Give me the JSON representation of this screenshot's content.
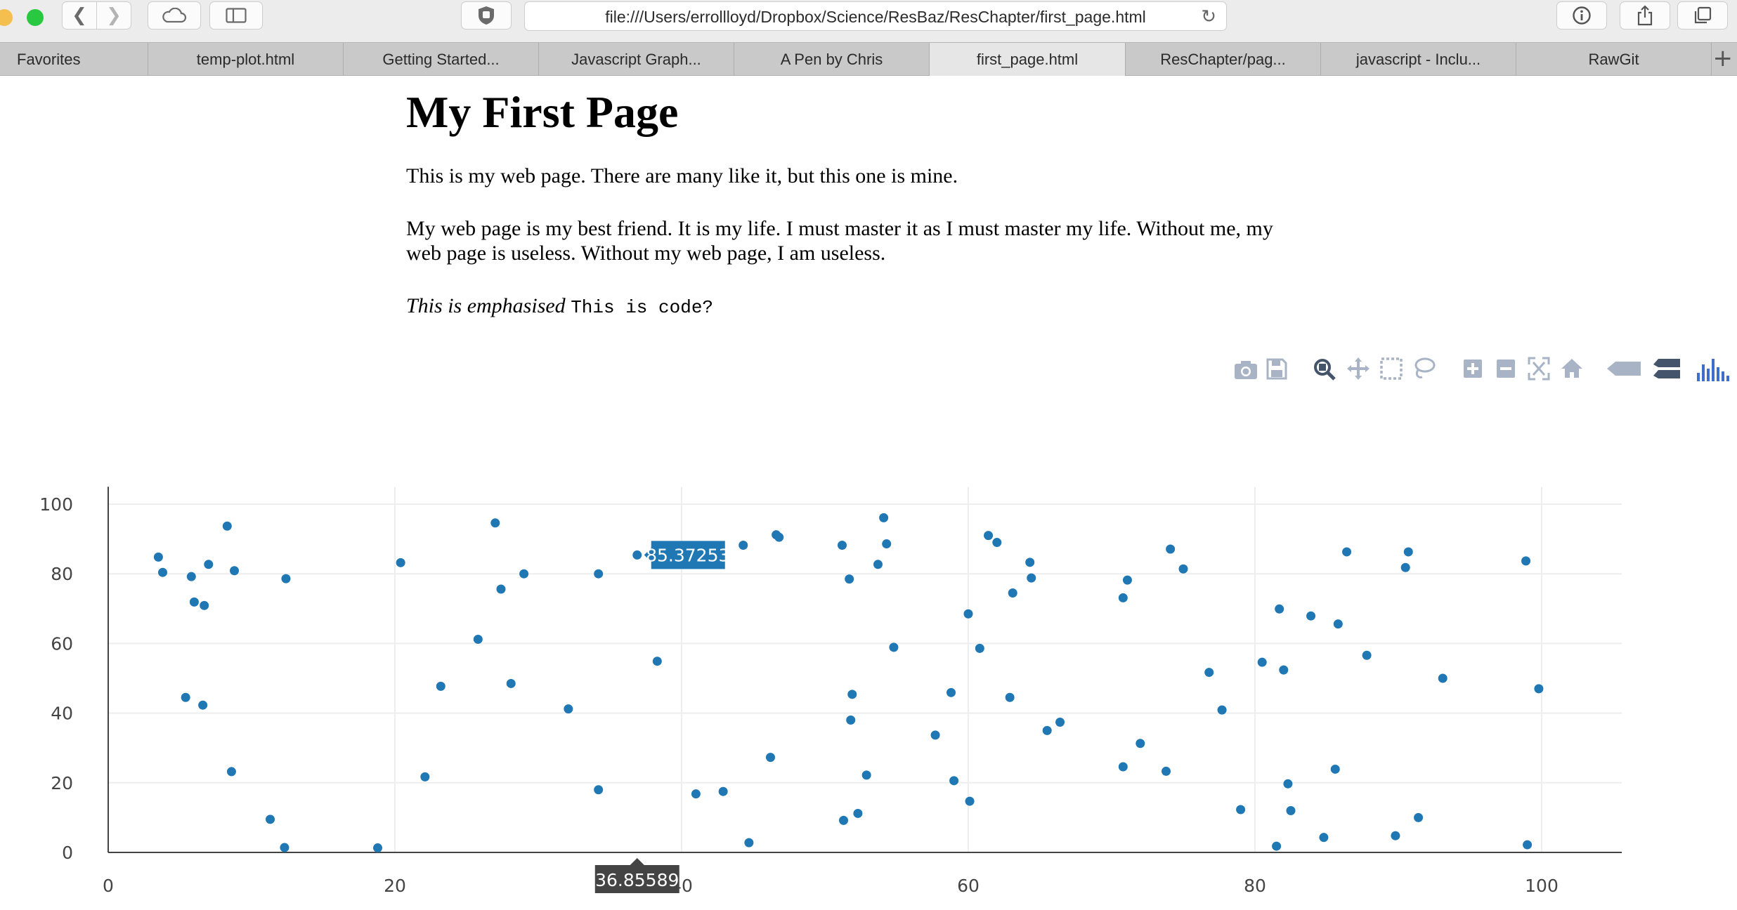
{
  "browser": {
    "url": "file:///Users/errollloyd/Dropbox/Science/ResBaz/ResChapter/first_page.html",
    "tabs": [
      {
        "label": "Favorites"
      },
      {
        "label": "temp-plot.html"
      },
      {
        "label": "Getting Started..."
      },
      {
        "label": "Javascript Graph..."
      },
      {
        "label": "A Pen by Chris"
      },
      {
        "label": "first_page.html",
        "active": true
      },
      {
        "label": "ResChapter/pag..."
      },
      {
        "label": "javascript - Inclu..."
      },
      {
        "label": "RawGit"
      }
    ]
  },
  "page": {
    "title": "My First Page",
    "paragraph1": "This is my web page. There are many like it, but this one is mine.",
    "paragraph2": "My web page is my best friend. It is my life. I must master it as I must master my life. Without me, my web page is useless. Without my web page, I am useless.",
    "emphasis": "This is emphasised",
    "code": "This is code?"
  },
  "modebar": [
    "camera-icon",
    "save-icon",
    "zoom-icon",
    "pan-icon",
    "box-select-icon",
    "lasso-icon",
    "zoom-in-icon",
    "zoom-out-icon",
    "autoscale-icon",
    "reset-axes-icon",
    "spike-lines-icon",
    "compare-hover-icon",
    "plotly-logo-icon"
  ],
  "chart_data": {
    "type": "scatter",
    "marker_color": "#1f77b4",
    "xlim": [
      0,
      105
    ],
    "ylim": [
      0,
      100
    ],
    "x_ticks": [
      0,
      20,
      40,
      60,
      80,
      100
    ],
    "y_ticks": [
      0,
      20,
      40,
      60,
      80,
      100
    ],
    "grid": true,
    "hover": {
      "x_label": "36.85589",
      "y_label": "85.37253"
    },
    "points": [
      [
        3.5,
        84.8
      ],
      [
        3.8,
        80.4
      ],
      [
        5.4,
        44.5
      ],
      [
        5.8,
        79.2
      ],
      [
        6.0,
        71.9
      ],
      [
        6.6,
        42.3
      ],
      [
        6.7,
        70.9
      ],
      [
        7.0,
        82.7
      ],
      [
        8.3,
        93.7
      ],
      [
        8.6,
        23.2
      ],
      [
        8.8,
        80.9
      ],
      [
        11.3,
        9.5
      ],
      [
        12.3,
        1.4
      ],
      [
        12.4,
        78.6
      ],
      [
        18.8,
        1.3
      ],
      [
        20.4,
        83.2
      ],
      [
        22.1,
        21.7
      ],
      [
        23.2,
        47.7
      ],
      [
        25.8,
        61.2
      ],
      [
        27.0,
        94.6
      ],
      [
        27.4,
        75.6
      ],
      [
        28.1,
        48.5
      ],
      [
        29.0,
        80.0
      ],
      [
        32.1,
        41.2
      ],
      [
        34.2,
        18.0
      ],
      [
        34.2,
        80.0
      ],
      [
        36.9,
        85.4
      ],
      [
        38.3,
        54.9
      ],
      [
        41.0,
        16.8
      ],
      [
        42.9,
        17.5
      ],
      [
        44.3,
        88.2
      ],
      [
        44.7,
        2.8
      ],
      [
        46.2,
        27.3
      ],
      [
        46.6,
        91.2
      ],
      [
        46.8,
        90.5
      ],
      [
        51.2,
        88.2
      ],
      [
        51.3,
        9.2
      ],
      [
        51.7,
        78.5
      ],
      [
        51.9,
        45.4
      ],
      [
        51.8,
        38.0
      ],
      [
        52.3,
        11.2
      ],
      [
        52.9,
        22.2
      ],
      [
        53.7,
        82.7
      ],
      [
        54.1,
        96.1
      ],
      [
        54.3,
        88.6
      ],
      [
        54.8,
        58.9
      ],
      [
        57.7,
        33.7
      ],
      [
        58.8,
        45.9
      ],
      [
        59.0,
        20.6
      ],
      [
        60.0,
        68.5
      ],
      [
        60.1,
        14.7
      ],
      [
        60.8,
        58.6
      ],
      [
        61.4,
        91.0
      ],
      [
        62.0,
        89.0
      ],
      [
        62.9,
        44.5
      ],
      [
        63.1,
        74.5
      ],
      [
        64.3,
        83.3
      ],
      [
        64.4,
        78.8
      ],
      [
        65.5,
        35.0
      ],
      [
        66.4,
        37.4
      ],
      [
        70.8,
        24.6
      ],
      [
        70.8,
        73.1
      ],
      [
        71.1,
        78.2
      ],
      [
        72.0,
        31.3
      ],
      [
        73.8,
        23.3
      ],
      [
        74.1,
        87.1
      ],
      [
        75.0,
        81.4
      ],
      [
        76.8,
        51.7
      ],
      [
        77.7,
        40.9
      ],
      [
        79.0,
        12.3
      ],
      [
        80.5,
        54.6
      ],
      [
        81.5,
        1.8
      ],
      [
        81.7,
        69.9
      ],
      [
        82.0,
        52.4
      ],
      [
        82.3,
        19.7
      ],
      [
        82.5,
        12.0
      ],
      [
        83.9,
        67.9
      ],
      [
        84.8,
        4.3
      ],
      [
        85.6,
        23.9
      ],
      [
        85.8,
        65.6
      ],
      [
        86.4,
        86.3
      ],
      [
        87.8,
        56.6
      ],
      [
        89.8,
        4.8
      ],
      [
        90.5,
        81.8
      ],
      [
        90.7,
        86.3
      ],
      [
        91.4,
        10.0
      ],
      [
        93.1,
        50.0
      ],
      [
        98.9,
        83.7
      ],
      [
        99.0,
        2.2
      ],
      [
        99.8,
        47.0
      ]
    ]
  }
}
